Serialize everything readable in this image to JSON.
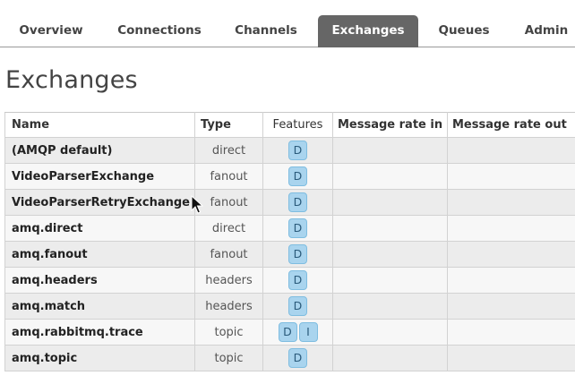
{
  "tabs": [
    {
      "label": "Overview"
    },
    {
      "label": "Connections"
    },
    {
      "label": "Channels"
    },
    {
      "label": "Exchanges",
      "active": true
    },
    {
      "label": "Queues"
    },
    {
      "label": "Admin"
    }
  ],
  "page_title": "Exchanges",
  "table": {
    "headers": {
      "name": "Name",
      "type": "Type",
      "features": "Features",
      "rate_in": "Message rate in",
      "rate_out": "Message rate out"
    },
    "rows": [
      {
        "name": "(AMQP default)",
        "type": "direct",
        "features": [
          "D"
        ]
      },
      {
        "name": "VideoParserExchange",
        "type": "fanout",
        "features": [
          "D"
        ]
      },
      {
        "name": "VideoParserRetryExchange",
        "type": "fanout",
        "features": [
          "D"
        ]
      },
      {
        "name": "amq.direct",
        "type": "direct",
        "features": [
          "D"
        ]
      },
      {
        "name": "amq.fanout",
        "type": "fanout",
        "features": [
          "D"
        ]
      },
      {
        "name": "amq.headers",
        "type": "headers",
        "features": [
          "D"
        ]
      },
      {
        "name": "amq.match",
        "type": "headers",
        "features": [
          "D"
        ]
      },
      {
        "name": "amq.rabbitmq.trace",
        "type": "topic",
        "features": [
          "D",
          "I"
        ]
      },
      {
        "name": "amq.topic",
        "type": "topic",
        "features": [
          "D"
        ]
      }
    ]
  },
  "colors": {
    "active_tab_bg": "#666666",
    "badge_bg": "#a9d4ee",
    "row_odd": "#ececec",
    "row_even": "#f7f7f7"
  },
  "icons": {
    "cursor": "mouse-pointer-icon"
  }
}
